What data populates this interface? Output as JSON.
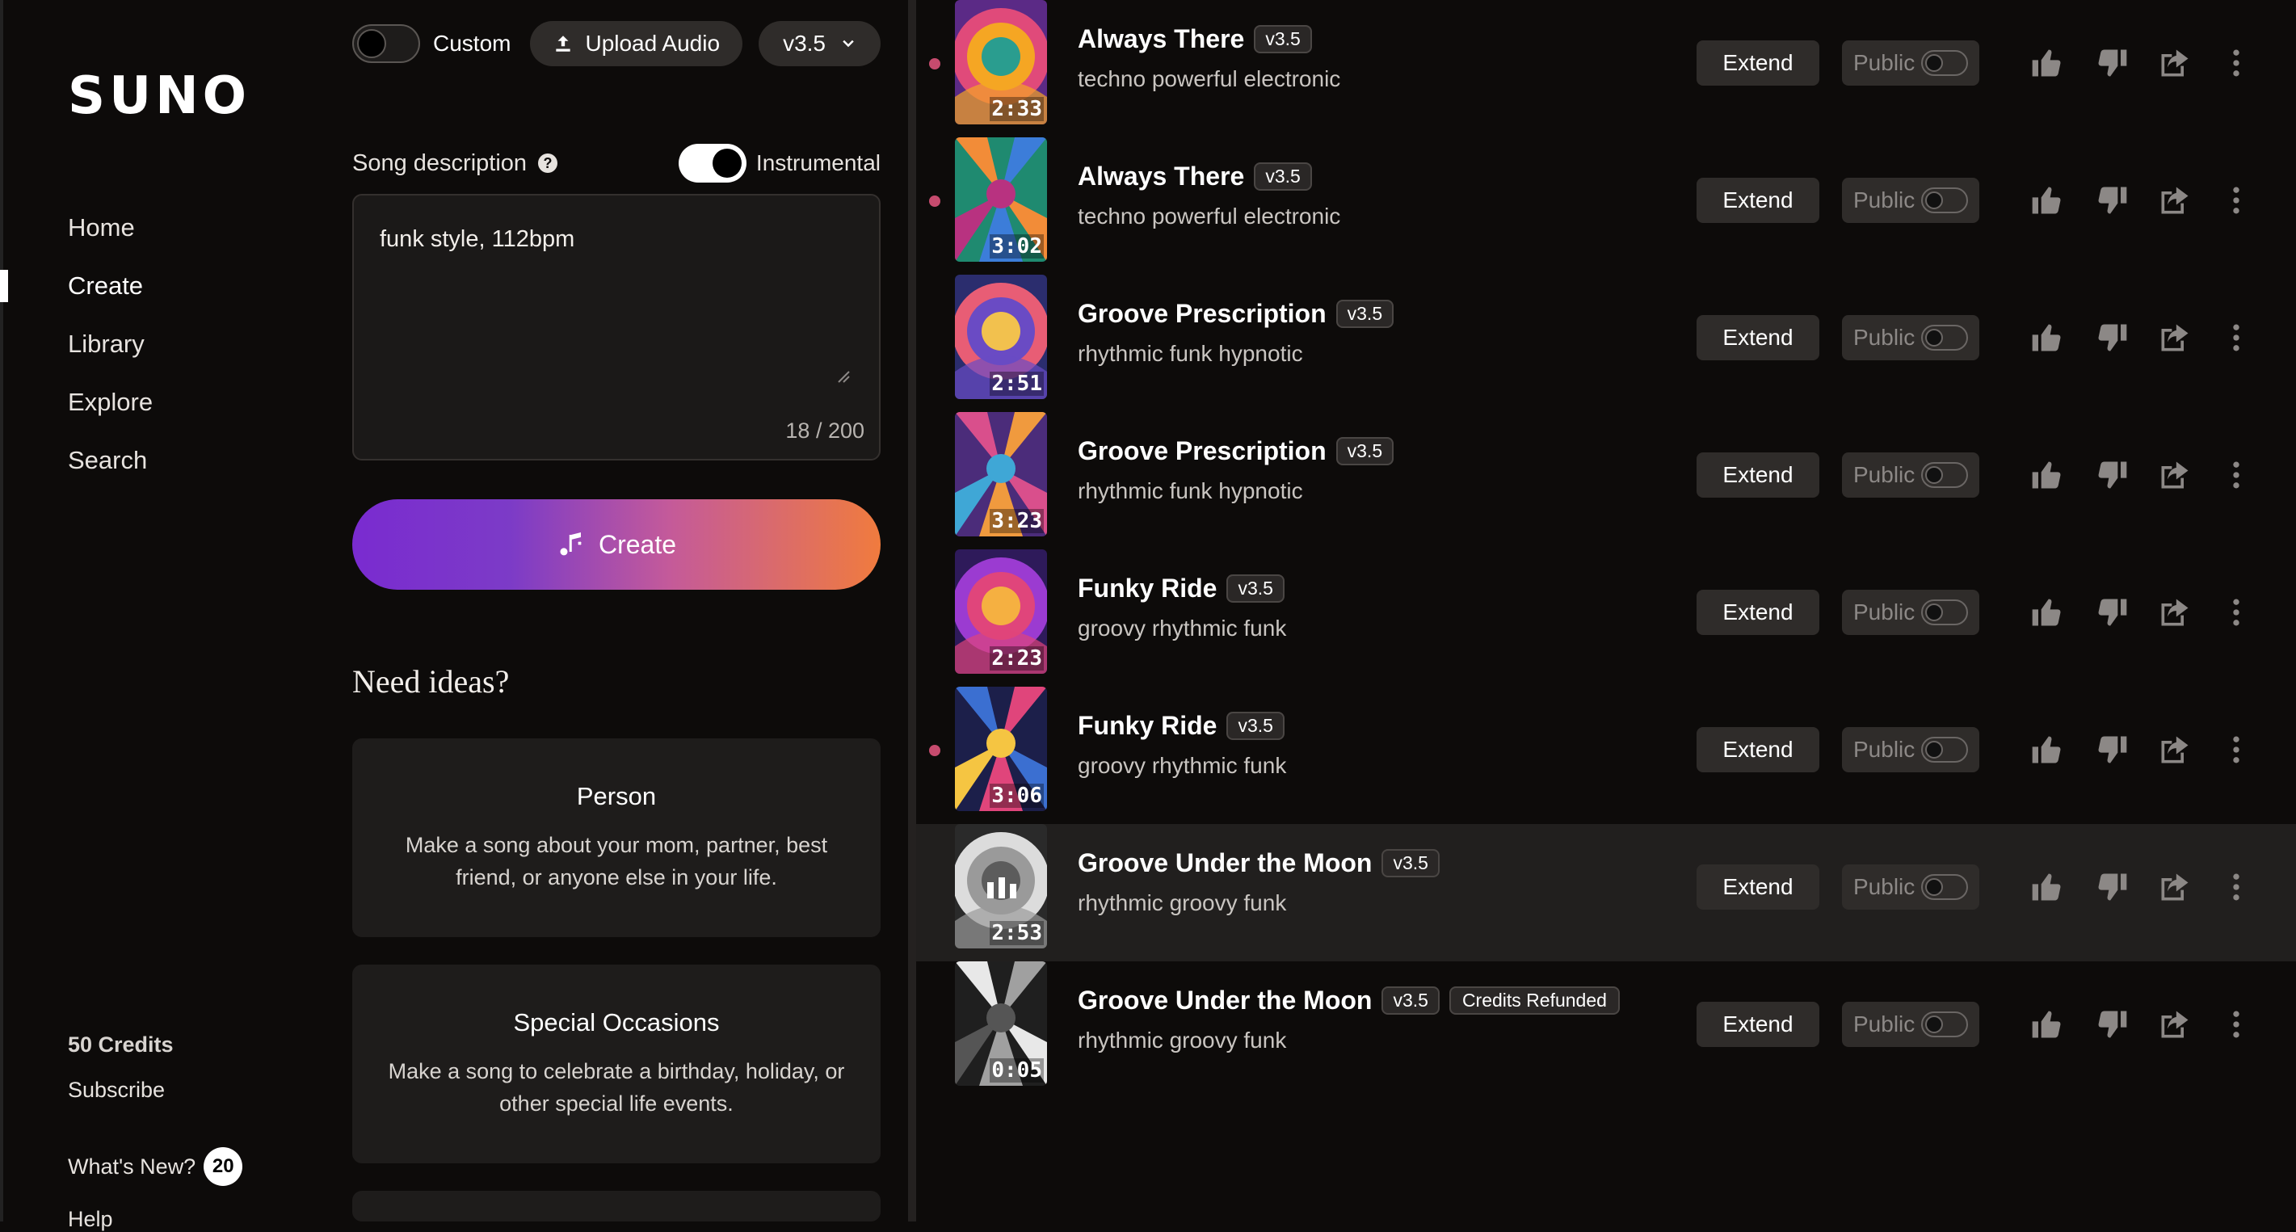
{
  "sidebar": {
    "logo": "SUNO",
    "nav": [
      "Home",
      "Create",
      "Library",
      "Explore",
      "Search"
    ],
    "active_nav": "Create",
    "credits": "50 Credits",
    "subscribe": "Subscribe",
    "whats_new": "What's New?",
    "whats_new_count": "20",
    "help": "Help"
  },
  "create": {
    "custom_label": "Custom",
    "upload_label": "Upload Audio",
    "version": "v3.5",
    "song_description_label": "Song description",
    "instrumental_label": "Instrumental",
    "instrumental_on": true,
    "description_value": "funk style, 112bpm",
    "char_count": "18 / 200",
    "create_button": "Create",
    "ideas_title": "Need ideas?",
    "ideas": [
      {
        "title": "Person",
        "desc": "Make a song about your mom, partner, best friend, or anyone else in your life."
      },
      {
        "title": "Special Occasions",
        "desc": "Make a song to celebrate a birthday, holiday, or other special life events."
      }
    ]
  },
  "songs": [
    {
      "title": "Always There",
      "version": "v3.5",
      "tags": "techno powerful electronic",
      "duration": "2:33",
      "dot": true,
      "palette": [
        "#e04a7a",
        "#f5a623",
        "#2a9d8f",
        "#5b2a86"
      ]
    },
    {
      "title": "Always There",
      "version": "v3.5",
      "tags": "techno powerful electronic",
      "duration": "3:02",
      "dot": true,
      "palette": [
        "#f28c38",
        "#3c7dd9",
        "#b83280",
        "#1f8a70"
      ]
    },
    {
      "title": "Groove Prescription",
      "version": "v3.5",
      "tags": "rhythmic funk hypnotic",
      "duration": "2:51",
      "dot": false,
      "palette": [
        "#e85d75",
        "#6a4bc4",
        "#f2c14e",
        "#2b2d6e"
      ]
    },
    {
      "title": "Groove Prescription",
      "version": "v3.5",
      "tags": "rhythmic funk hypnotic",
      "duration": "3:23",
      "dot": false,
      "palette": [
        "#d94f8c",
        "#f09a3e",
        "#3fa7d6",
        "#4b2c7a"
      ]
    },
    {
      "title": "Funky Ride",
      "version": "v3.5",
      "tags": "groovy rhythmic funk",
      "duration": "2:23",
      "dot": false,
      "palette": [
        "#9b3bd1",
        "#e0457b",
        "#f5b041",
        "#2e1a5a"
      ]
    },
    {
      "title": "Funky Ride",
      "version": "v3.5",
      "tags": "groovy rhythmic funk",
      "duration": "3:06",
      "dot": true,
      "palette": [
        "#3b6fd1",
        "#e0457b",
        "#f5c542",
        "#1c1f4a"
      ]
    },
    {
      "title": "Groove Under the Moon",
      "version": "v3.5",
      "tags": "rhythmic groovy funk",
      "duration": "2:53",
      "dot": false,
      "palette": [
        "#dcdcdc",
        "#9a9a9a",
        "#5c5c5c",
        "#2a2a2a"
      ],
      "playing": true
    },
    {
      "title": "Groove Under the Moon",
      "version": "v3.5",
      "tags": "rhythmic groovy funk",
      "duration": "0:05",
      "dot": false,
      "palette": [
        "#e8e8e8",
        "#a0a0a0",
        "#555555",
        "#1f1f1f"
      ],
      "badge": "Credits Refunded"
    }
  ],
  "row_labels": {
    "extend": "Extend",
    "public": "Public"
  },
  "icons": [
    "upload-icon",
    "chevron-down-icon",
    "help-icon",
    "music-note-icon",
    "thumbs-up-icon",
    "thumbs-down-icon",
    "share-icon",
    "more-vertical-icon",
    "playing-bars-icon"
  ],
  "colors": {
    "accent_dot": "#c64b6e",
    "button_bg": "#2f2c2a",
    "create_gradient_start": "#7a2bd0",
    "create_gradient_end": "#f07b3e"
  }
}
